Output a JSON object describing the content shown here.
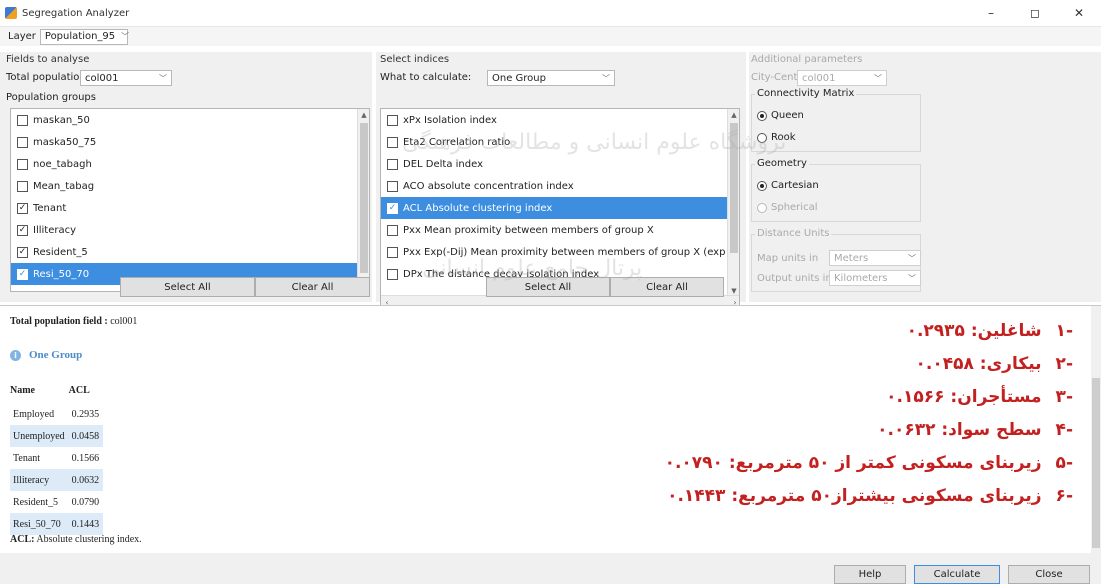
{
  "window": {
    "title": "Segregation Analyzer",
    "controls": [
      "–",
      "◻",
      "✕"
    ]
  },
  "layer": {
    "label": "Layer",
    "value": "Population_95"
  },
  "fields_panel": {
    "title": "Fields to analyse",
    "total_population_label": "Total population:",
    "total_population_value": "col001",
    "groups_label": "Population groups",
    "groups": [
      {
        "label": "maskan_50",
        "checked": false,
        "selected": false
      },
      {
        "label": "maska50_75",
        "checked": false,
        "selected": false
      },
      {
        "label": "noe_tabagh",
        "checked": false,
        "selected": false
      },
      {
        "label": "Mean_tabag",
        "checked": false,
        "selected": false
      },
      {
        "label": "Tenant",
        "checked": true,
        "selected": false
      },
      {
        "label": "Illiteracy",
        "checked": true,
        "selected": false
      },
      {
        "label": "Resident_5",
        "checked": true,
        "selected": false
      },
      {
        "label": "Resi_50_70",
        "checked": true,
        "selected": true
      }
    ],
    "select_all": "Select All",
    "clear_all": "Clear All"
  },
  "indices_panel": {
    "title": "Select indices",
    "what_label": "What to calculate:",
    "what_value": "One Group",
    "indices": [
      {
        "label": "xPx Isolation index",
        "checked": false,
        "selected": false
      },
      {
        "label": "Eta2 Correlation ratio",
        "checked": false,
        "selected": false
      },
      {
        "label": "DEL Delta index",
        "checked": false,
        "selected": false
      },
      {
        "label": "ACO absolute concentration index",
        "checked": false,
        "selected": false
      },
      {
        "label": "ACL Absolute clustering index",
        "checked": true,
        "selected": true
      },
      {
        "label": "Pxx Mean proximity between members of group X",
        "checked": false,
        "selected": false
      },
      {
        "label": "Pxx Exp(-Dij) Mean proximity between members of group X (exp dij)",
        "checked": false,
        "selected": false
      },
      {
        "label": "DPx The distance decay isolation index",
        "checked": false,
        "selected": false
      }
    ],
    "select_all": "Select All",
    "clear_all": "Clear All"
  },
  "params_panel": {
    "title": "Additional parameters",
    "city_center_label": "City-Center",
    "city_center_value": "col001",
    "connectivity_title": "Connectivity Matrix",
    "connectivity_options": [
      {
        "label": "Queen",
        "selected": true
      },
      {
        "label": "Rook",
        "selected": false
      }
    ],
    "geometry_title": "Geometry",
    "geometry_options": [
      {
        "label": "Cartesian",
        "selected": true,
        "enabled": true
      },
      {
        "label": "Spherical",
        "selected": false,
        "enabled": false
      }
    ],
    "distance_title": "Distance Units",
    "map_units_label": "Map units in",
    "map_units_value": "Meters",
    "output_units_label": "Output units in",
    "output_units_value": "Kilometers"
  },
  "output": {
    "heading_label": "Total population field :",
    "heading_value": "col001",
    "group_title": "One Group",
    "columns": [
      "Name",
      "ACL"
    ],
    "rows": [
      {
        "name": "Employed",
        "value": "0.2935",
        "highlight": false
      },
      {
        "name": "Unemployed",
        "value": "0.0458",
        "highlight": true
      },
      {
        "name": "Tenant",
        "value": "0.1566",
        "highlight": false
      },
      {
        "name": "Illiteracy",
        "value": "0.0632",
        "highlight": true
      },
      {
        "name": "Resident_5",
        "value": "0.0790",
        "highlight": false
      },
      {
        "name": "Resi_50_70",
        "value": "0.1443",
        "highlight": true
      }
    ],
    "note_label": "ACL:",
    "note_text": "Absolute clustering index.",
    "farsi_lines": [
      {
        "num": "-۱",
        "text": "شاغلین: ۰.۲۹۳۵"
      },
      {
        "num": "-۲",
        "text": "بیکاری: ۰.۰۴۵۸"
      },
      {
        "num": "-۳",
        "text": "مستأجران: ۰.۱۵۶۶"
      },
      {
        "num": "-۴",
        "text": "سطح سواد: ۰.۰۶۳۲"
      },
      {
        "num": "-۵",
        "text": "زیربنای مسکونی کمتر از ۵۰ مترمربع: ۰.۰۷۹۰"
      },
      {
        "num": "-۶",
        "text": "زیربنای مسکونی بیشتراز۵۰ مترمربع: ۰.۱۴۴۳"
      }
    ]
  },
  "footer": {
    "help": "Help",
    "calculate": "Calculate",
    "close": "Close"
  },
  "watermark": {
    "line1": "ثروشگاه علوم انسانی و مطالعات فرهنگی",
    "line2": "پرتال جامع علوم انسانی"
  },
  "colors": {
    "selection": "#3d8ee0",
    "row_highlight": "#dcebf7",
    "farsi_text": "#c32020",
    "group_title": "#4a8cc8"
  }
}
